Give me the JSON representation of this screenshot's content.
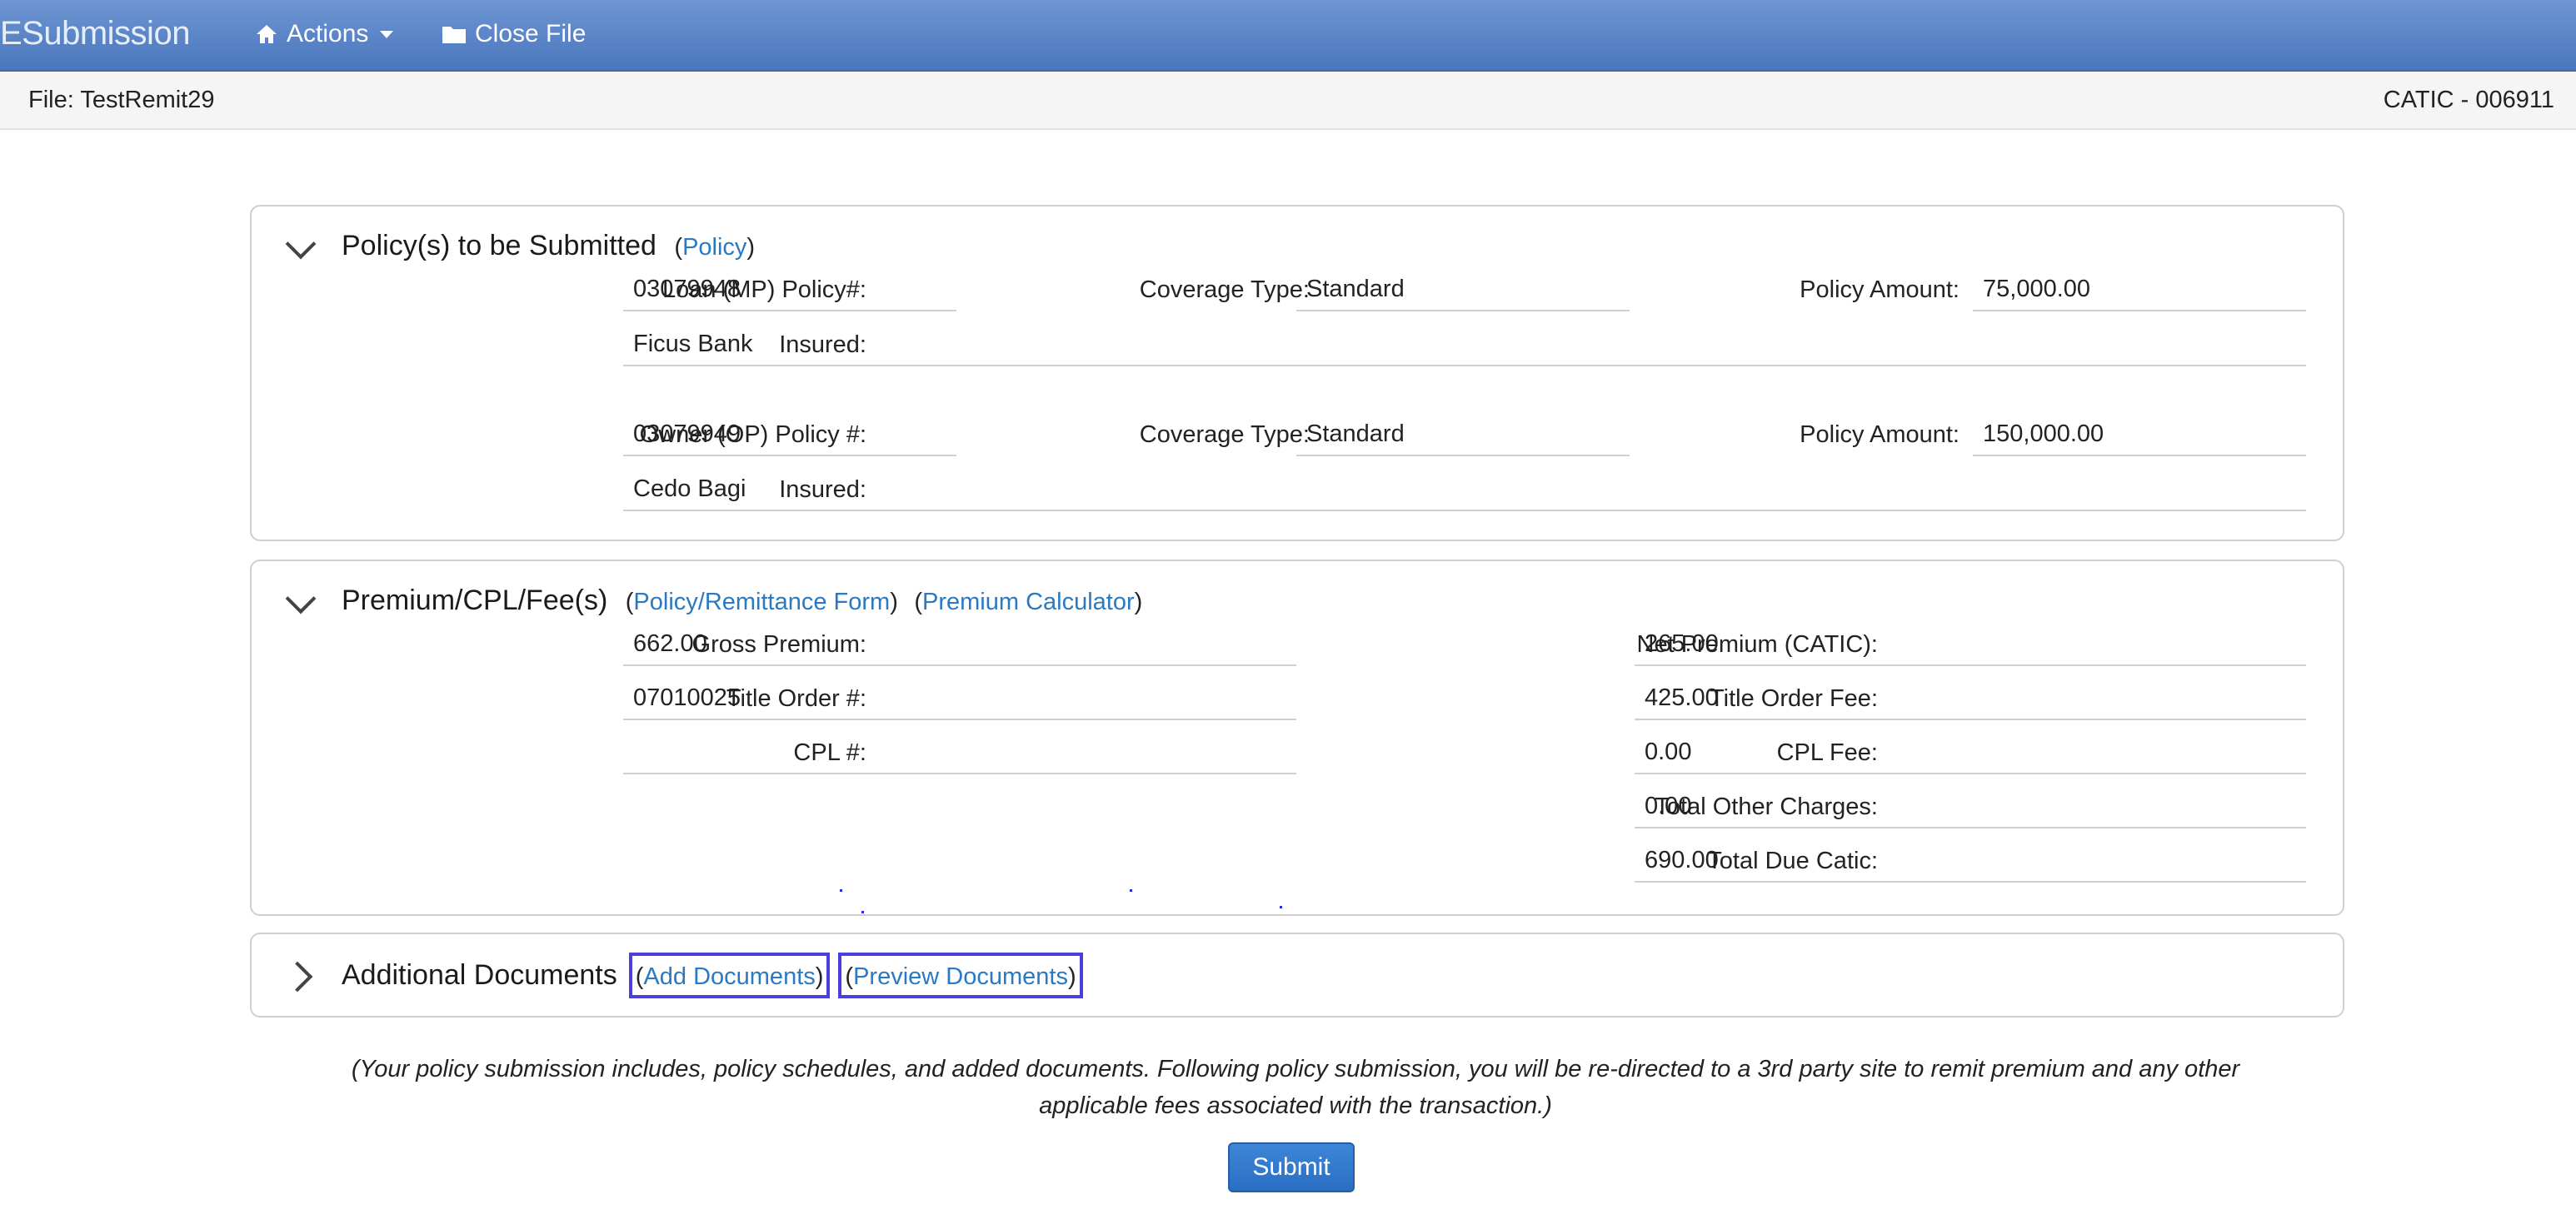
{
  "navbar": {
    "brand": "ESubmission",
    "actions_label": "Actions",
    "close_label": "Close File",
    "actions_icon": "home-icon",
    "close_icon": "folder-icon"
  },
  "filebar": {
    "file_text": "File: TestRemit29",
    "catic_text": "CATIC - 006911"
  },
  "policies": {
    "title": "Policy(s) to be Submitted",
    "link": "Policy",
    "loan": {
      "policy_label": "Loan (MP) Policy#:",
      "policy_value": "03079948",
      "coverage_label": "Coverage Type:",
      "coverage_value": "Standard",
      "amount_label": "Policy Amount:",
      "amount_value": "75,000.00",
      "insured_label": "Insured:",
      "insured_value": "Ficus Bank"
    },
    "owner": {
      "policy_label": "Owner (OP) Policy #:",
      "policy_value": "03079949",
      "coverage_label": "Coverage Type:",
      "coverage_value": "Standard",
      "amount_label": "Policy Amount:",
      "amount_value": "150,000.00",
      "insured_label": "Insured:",
      "insured_value": "Cedo Bagi"
    }
  },
  "premium": {
    "title": "Premium/CPL/Fee(s)",
    "link1": "Policy/Remittance Form",
    "link2": "Premium Calculator",
    "gross_label": "Gross Premium:",
    "gross_value": "662.00",
    "title_order_label": "Title Order #:",
    "title_order_value": "07010025",
    "cpl_label": "CPL #:",
    "cpl_value": "",
    "net_label": "Net Premium (CATIC):",
    "net_value": "265.00",
    "title_fee_label": "Title Order Fee:",
    "title_fee_value": "425.00",
    "cpl_fee_label": "CPL Fee:",
    "cpl_fee_value": "0.00",
    "other_label": "Total Other Charges:",
    "other_value": "0.00",
    "due_label": "Total Due Catic:",
    "due_value": "690.00"
  },
  "documents": {
    "title": "Additional Documents",
    "add_link": "Add Documents",
    "preview_link": "Preview Documents"
  },
  "note": {
    "line1": "(Your policy submission includes, policy schedules, and added documents. Following policy submission, you will be re-directed to a 3rd party site to remit premium and any other",
    "line2": "applicable fees associated with the transaction.)"
  },
  "submit_label": "Submit",
  "colors": {
    "navbar": "#5a84c8",
    "link": "#2a79c3",
    "highlight_box": "#4a3fdd",
    "submit": "#2f76cc"
  }
}
